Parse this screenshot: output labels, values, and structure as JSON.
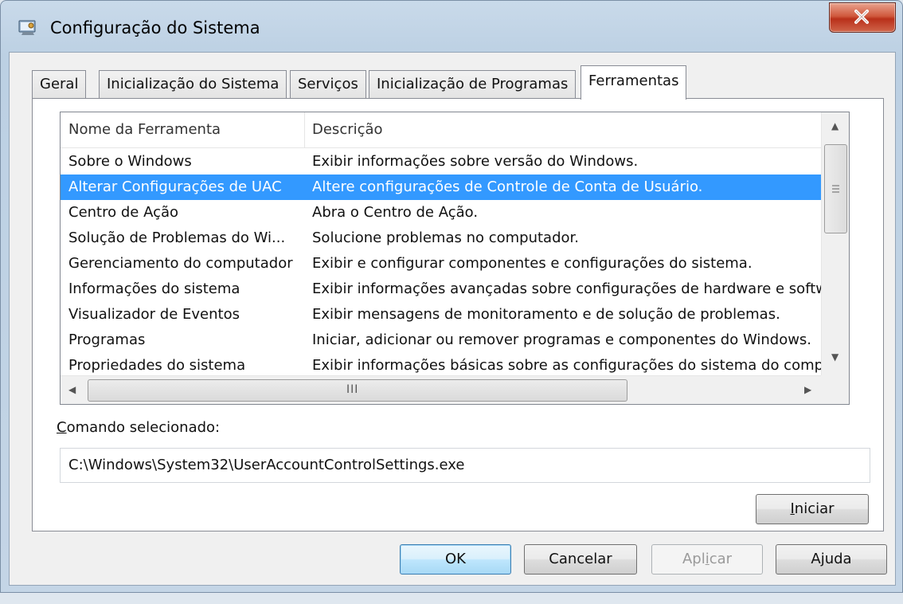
{
  "window": {
    "title": "Configuração do Sistema"
  },
  "tabs": [
    {
      "label": "Geral"
    },
    {
      "label": "Inicialização do Sistema"
    },
    {
      "label": "Serviços"
    },
    {
      "label": "Inicialização de Programas"
    },
    {
      "label": "Ferramentas",
      "active": true
    }
  ],
  "tools_list": {
    "columns": [
      "Nome da Ferramenta",
      "Descrição"
    ],
    "selected_index": 1,
    "rows": [
      {
        "name": "Sobre o Windows",
        "description": "Exibir informações sobre versão do Windows."
      },
      {
        "name": "Alterar Configurações de UAC",
        "description": "Altere configurações de Controle de Conta de Usuário."
      },
      {
        "name": "Centro de Ação",
        "description": "Abra o Centro de Ação."
      },
      {
        "name": "Solução de Problemas do Wi...",
        "description": "Solucione problemas no computador."
      },
      {
        "name": "Gerenciamento do computador",
        "description": "Exibir e configurar componentes e configurações do sistema."
      },
      {
        "name": "Informações do sistema",
        "description": "Exibir informações avançadas sobre configurações de hardware e softw"
      },
      {
        "name": "Visualizador de Eventos",
        "description": "Exibir mensagens de monitoramento e de solução de problemas."
      },
      {
        "name": "Programas",
        "description": "Iniciar, adicionar ou remover programas e componentes do Windows."
      },
      {
        "name": "Propriedades do sistema",
        "description": "Exibir informações básicas sobre as configurações do sistema do comput"
      }
    ],
    "hscroll_grip": "III"
  },
  "command": {
    "label_accel": "C",
    "label_rest": "omando selecionado:",
    "value": "C:\\Windows\\System32\\UserAccountControlSettings.exe"
  },
  "buttons": {
    "launch_accel": "I",
    "launch_rest": "niciar",
    "ok": "OK",
    "cancel": "Cancelar",
    "apply_pre": "Apl",
    "apply_accel": "i",
    "apply_post": "car",
    "help": "Ajuda"
  },
  "colors": {
    "selection": "#3399ff",
    "ok_border": "#3c7fb1",
    "close_red": "#c7432a"
  }
}
